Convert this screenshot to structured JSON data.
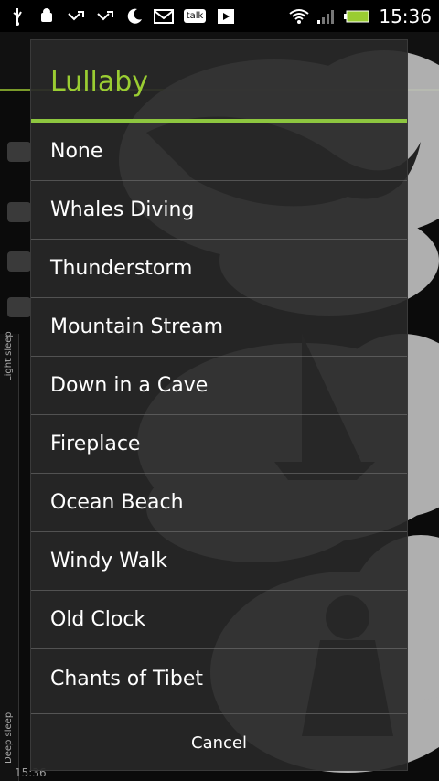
{
  "status_bar": {
    "time": "15:36",
    "icons": [
      "usb-icon",
      "android-debug-icon",
      "missed-call-icon",
      "missed-call-icon",
      "moon-icon",
      "gmail-icon",
      "talk-icon",
      "play-store-icon",
      "wifi-icon",
      "signal-icon",
      "battery-icon"
    ],
    "talk_label": "talk"
  },
  "background": {
    "light_sleep_label": "Light sleep",
    "deep_sleep_label": "Deep sleep",
    "time_bottom": "15:36"
  },
  "dialog": {
    "title": "Lullaby",
    "accent_color": "#8dc63f",
    "options": [
      {
        "label": "None"
      },
      {
        "label": "Whales Diving"
      },
      {
        "label": "Thunderstorm"
      },
      {
        "label": "Mountain Stream"
      },
      {
        "label": "Down in a Cave"
      },
      {
        "label": "Fireplace"
      },
      {
        "label": "Ocean Beach"
      },
      {
        "label": "Windy Walk"
      },
      {
        "label": "Old Clock"
      },
      {
        "label": "Chants of Tibet"
      }
    ],
    "cancel_label": "Cancel"
  }
}
